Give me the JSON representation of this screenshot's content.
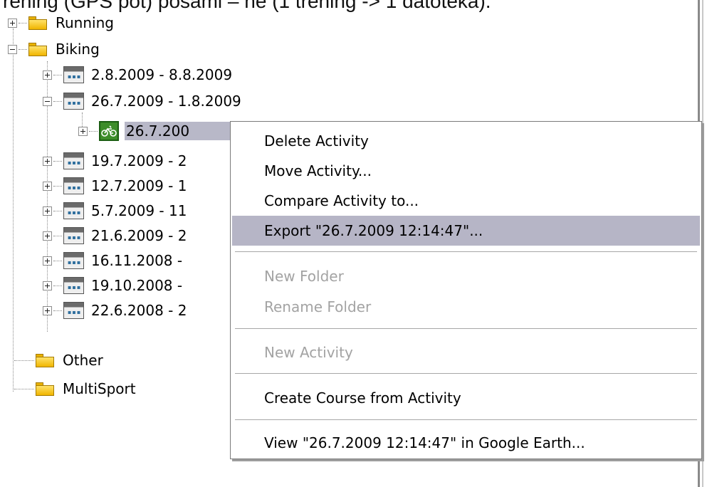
{
  "caption": "rening (GPS pot) posami – ne (1 trening -> 1 datoteka).",
  "tree": {
    "running": "Running",
    "biking": "Biking",
    "weeks": [
      "2.8.2009 - 8.8.2009",
      "26.7.2009 - 1.8.2009",
      "19.7.2009 - 2",
      "12.7.2009 - 1",
      "5.7.2009 - 11",
      "21.6.2009 - 2",
      "16.11.2008 -",
      "19.10.2008 -",
      "22.6.2008 - 2"
    ],
    "activity": "26.7.200",
    "other": "Other",
    "multisport": "MultiSport"
  },
  "menu": {
    "delete_activity": "Delete Activity",
    "move_activity": "Move Activity...",
    "compare_activity": "Compare Activity to...",
    "export": "Export \"26.7.2009 12:14:47\"...",
    "new_folder": "New Folder",
    "rename_folder": "Rename Folder",
    "new_activity": "New Activity",
    "create_course": "Create Course from Activity",
    "view_google_earth": "View \"26.7.2009 12:14:47\" in Google Earth..."
  }
}
